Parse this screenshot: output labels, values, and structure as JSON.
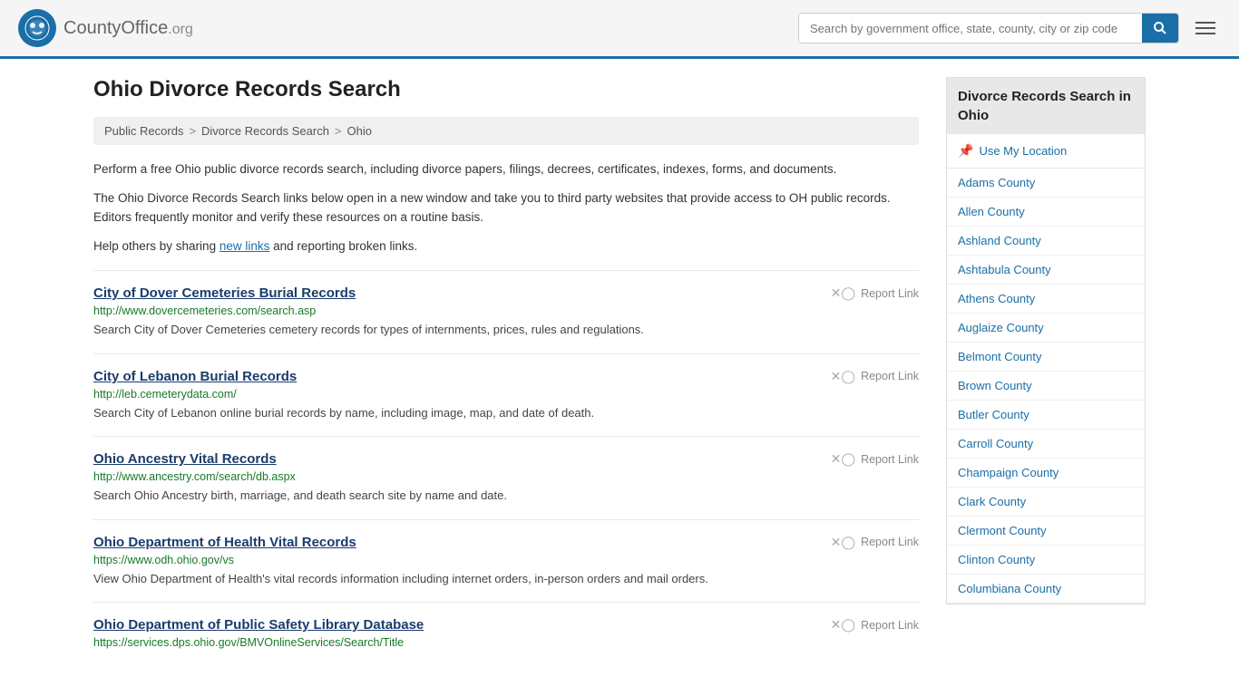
{
  "header": {
    "logo_text": "CountyOffice",
    "logo_suffix": ".org",
    "search_placeholder": "Search by government office, state, county, city or zip code",
    "search_value": ""
  },
  "page": {
    "title": "Ohio Divorce Records Search",
    "breadcrumbs": [
      "Public Records",
      "Divorce Records Search",
      "Ohio"
    ],
    "description1": "Perform a free Ohio public divorce records search, including divorce papers, filings, decrees, certificates, indexes, forms, and documents.",
    "description2": "The Ohio Divorce Records Search links below open in a new window and take you to third party websites that provide access to OH public records. Editors frequently monitor and verify these resources on a routine basis.",
    "description3_prefix": "Help others by sharing ",
    "description3_link": "new links",
    "description3_suffix": " and reporting broken links."
  },
  "records": [
    {
      "title": "City of Dover Cemeteries Burial Records",
      "url": "http://www.dovercemeteries.com/search.asp",
      "desc": "Search City of Dover Cemeteries cemetery records for types of internments, prices, rules and regulations.",
      "report": "Report Link"
    },
    {
      "title": "City of Lebanon Burial Records",
      "url": "http://leb.cemeterydata.com/",
      "desc": "Search City of Lebanon online burial records by name, including image, map, and date of death.",
      "report": "Report Link"
    },
    {
      "title": "Ohio Ancestry Vital Records",
      "url": "http://www.ancestry.com/search/db.aspx",
      "desc": "Search Ohio Ancestry birth, marriage, and death search site by name and date.",
      "report": "Report Link"
    },
    {
      "title": "Ohio Department of Health Vital Records",
      "url": "https://www.odh.ohio.gov/vs",
      "desc": "View Ohio Department of Health's vital records information including internet orders, in-person orders and mail orders.",
      "report": "Report Link"
    },
    {
      "title": "Ohio Department of Public Safety Library Database",
      "url": "https://services.dps.ohio.gov/BMVOnlineServices/Search/Title",
      "desc": "",
      "report": "Report Link"
    }
  ],
  "sidebar": {
    "heading": "Divorce Records Search in Ohio",
    "location_label": "Use My Location",
    "counties": [
      "Adams County",
      "Allen County",
      "Ashland County",
      "Ashtabula County",
      "Athens County",
      "Auglaize County",
      "Belmont County",
      "Brown County",
      "Butler County",
      "Carroll County",
      "Champaign County",
      "Clark County",
      "Clermont County",
      "Clinton County",
      "Columbiana County"
    ]
  }
}
